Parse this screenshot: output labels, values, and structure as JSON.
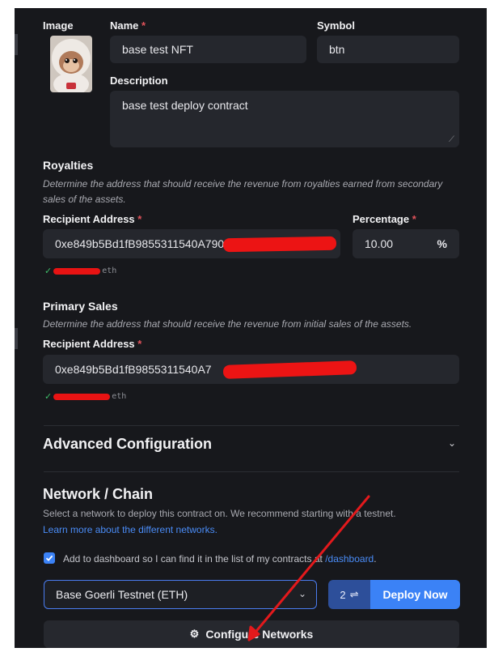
{
  "nft": {
    "image_label": "Image",
    "name_label": "Name",
    "name_value": "base test NFT",
    "symbol_label": "Symbol",
    "symbol_value": "btn",
    "description_label": "Description",
    "description_value": "base test deploy contract",
    "required_mark": "*"
  },
  "royalties": {
    "title": "Royalties",
    "help": "Determine the address that should receive the revenue from royalties earned from secondary sales of the assets.",
    "recipient_label": "Recipient Address",
    "recipient_value": "0xe849b5Bd1fB9855311540A7903748",
    "recipient_validation": "eth",
    "percentage_label": "Percentage",
    "percentage_value": "10.00",
    "percentage_unit": "%"
  },
  "primary_sales": {
    "title": "Primary Sales",
    "help": "Determine the address that should receive the revenue from initial sales of the assets.",
    "recipient_label": "Recipient Address",
    "recipient_value": "0xe849b5Bd1fB9855311540A7",
    "recipient_validation": "eth"
  },
  "advanced": {
    "title": "Advanced Configuration"
  },
  "network": {
    "title": "Network / Chain",
    "description": "Select a network to deploy this contract on. We recommend starting with a testnet.",
    "learn_more": "Learn more about the different networks.",
    "dashboard_text": "Add to dashboard so I can find it in the list of my contracts at",
    "dashboard_link": "/dashboard",
    "dashboard_suffix": ".",
    "dashboard_checked": true,
    "selected_network": "Base Goerli Testnet (ETH)",
    "deploy_count": "2",
    "deploy_label": "Deploy Now",
    "configure_label": "Configure Networks"
  },
  "colors": {
    "background": "#17181c",
    "field": "#25272d",
    "accent": "#3b82f6",
    "link": "#4a8cf7",
    "required": "#e0525a",
    "annotation": "#ec1414"
  },
  "icons": {
    "select_chevron": "chevron-down-icon",
    "advanced_chevron": "chevron-down-icon",
    "swap": "swap-icon",
    "gear": "gear-icon",
    "check": "check-icon",
    "arrow": "red-arrow-annotation"
  }
}
